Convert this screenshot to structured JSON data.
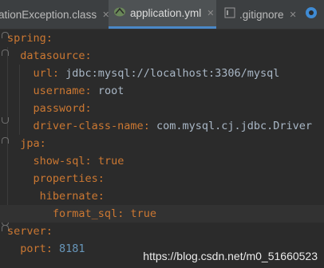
{
  "tabs": [
    {
      "label": "ationException.class",
      "icon": "class-file-icon",
      "active": false
    },
    {
      "label": "application.yml",
      "icon": "yaml-file-icon",
      "active": true
    },
    {
      "label": ".gitignore",
      "icon": "gitignore-file-icon",
      "active": false
    },
    {
      "label": "",
      "icon": "java-file-icon",
      "active": false
    }
  ],
  "code": [
    {
      "indent": "",
      "key": "spring",
      "value": ""
    },
    {
      "indent": "  ",
      "key": "datasource",
      "value": ""
    },
    {
      "indent": "    ",
      "key": "url",
      "value": "jdbc:mysql://localhost:3306/mysql"
    },
    {
      "indent": "    ",
      "key": "username",
      "value": "root"
    },
    {
      "indent": "    ",
      "key": "password",
      "value": ""
    },
    {
      "indent": "    ",
      "key": "driver-class-name",
      "value": "com.mysql.cj.jdbc.Driver"
    },
    {
      "indent": "  ",
      "key": "jpa",
      "value": ""
    },
    {
      "indent": "    ",
      "key": "show-sql",
      "value": "true"
    },
    {
      "indent": "    ",
      "key": "properties",
      "value": ""
    },
    {
      "indent": "     ",
      "key": "hibernate",
      "value": ""
    },
    {
      "indent": "       ",
      "key": "format_sql",
      "value": "true"
    },
    {
      "indent": "",
      "key": "server",
      "value": ""
    },
    {
      "indent": "  ",
      "key": "port",
      "value": "8181"
    }
  ],
  "watermark": "https://blog.csdn.net/m0_51660523",
  "colors": {
    "key": "#cc7832",
    "value": "#a9b7c6",
    "number": "#6897bb",
    "background": "#2b2b2b"
  }
}
